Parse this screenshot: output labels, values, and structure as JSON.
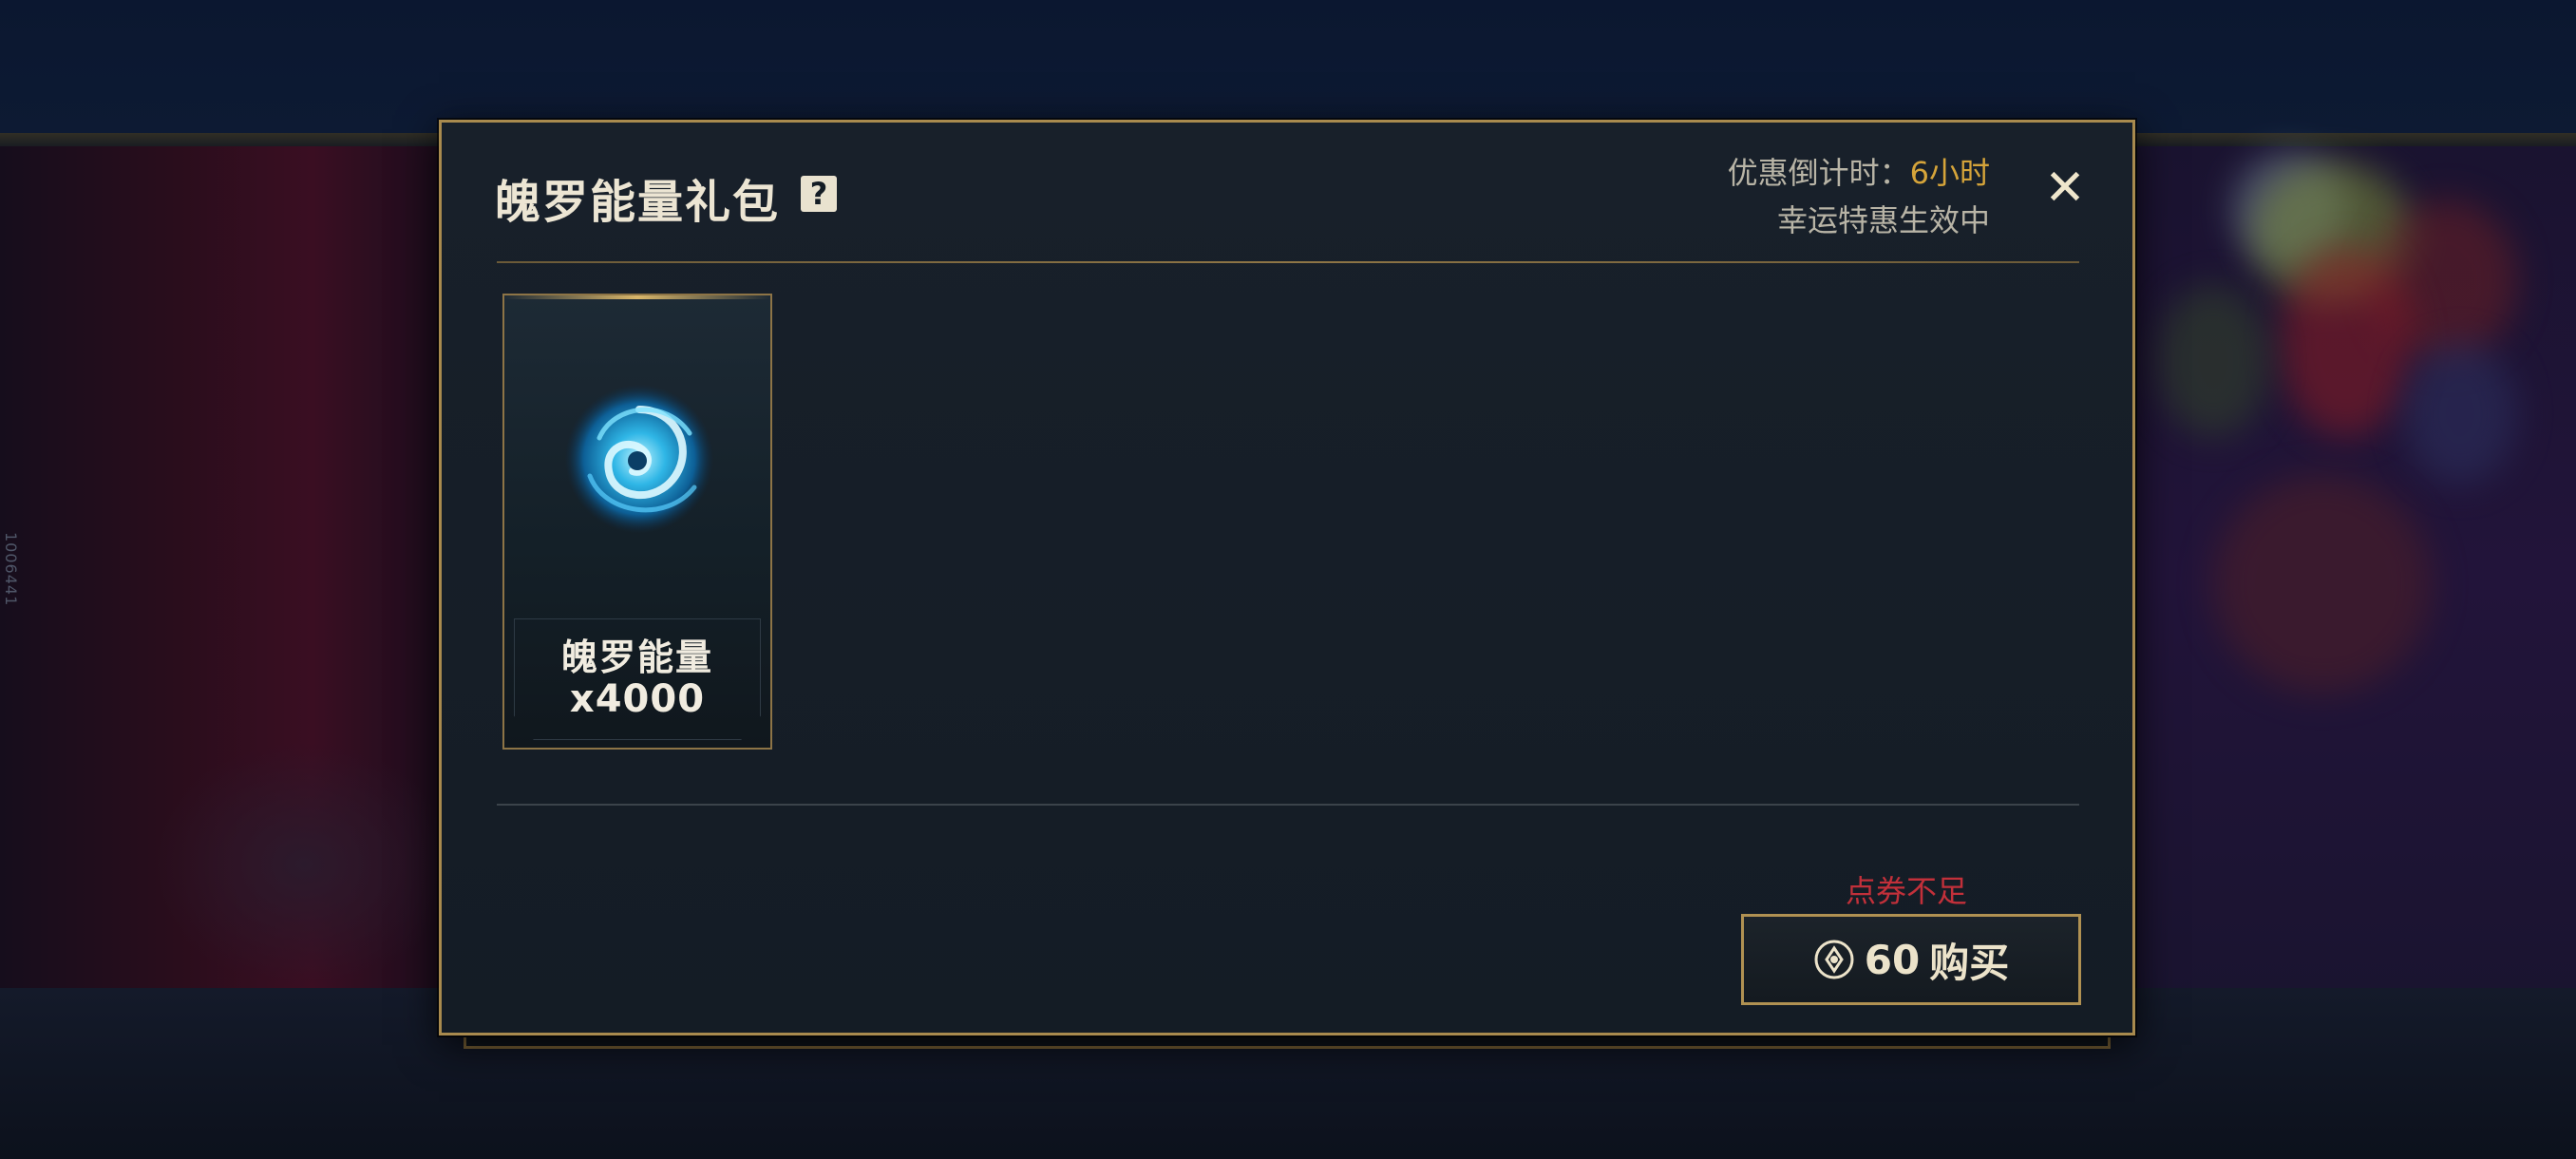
{
  "dialog": {
    "title": "魄罗能量礼包",
    "help_icon": "question-mark-icon",
    "countdown_label": "优惠倒计时：",
    "countdown_value": "6小时",
    "promo_status": "幸运特惠生效中",
    "close_icon": "close-icon"
  },
  "item": {
    "name": "魄罗能量",
    "quantity": "x4000",
    "icon": "poro-energy-swirl-icon"
  },
  "purchase": {
    "warning": "点券不足",
    "price": "60",
    "button_label": "购买",
    "currency_icon": "coupon-coin-icon"
  },
  "side_id": "1006441",
  "colors": {
    "accent_gold": "#a88a4e",
    "highlight": "#d5a43a",
    "warning": "#c2303a"
  }
}
